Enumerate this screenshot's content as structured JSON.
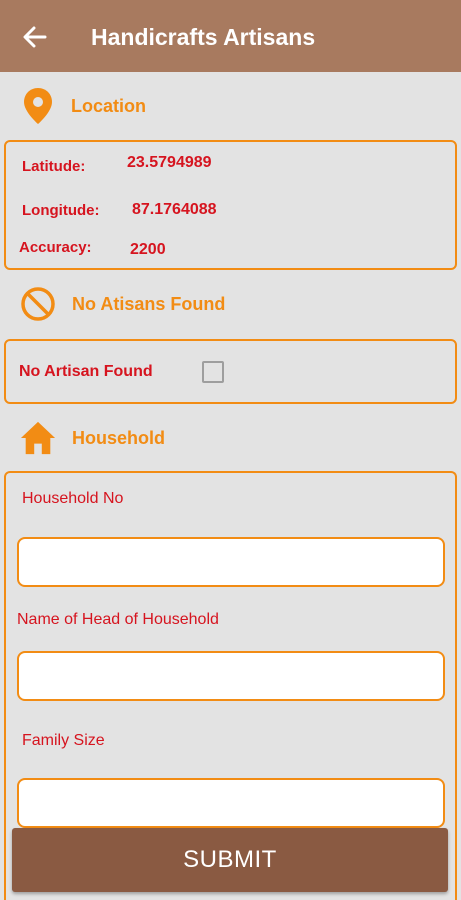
{
  "app_bar": {
    "title": "Handicrafts Artisans",
    "back_icon": "arrow-left-icon",
    "color": "#a87a5f"
  },
  "location": {
    "section_title": "Location",
    "icon": "location-pin-icon",
    "latitude_label": "Latitude:",
    "latitude_value": "23.5794989",
    "longitude_label": "Longitude:",
    "longitude_value": "87.1764088",
    "accuracy_label": "Accuracy:",
    "accuracy_value": "2200"
  },
  "no_artisans": {
    "section_title": "No Atisans Found",
    "icon": "prohibited-icon",
    "checkbox_label": "No Artisan Found",
    "checked": false
  },
  "household": {
    "section_title": "Household",
    "icon": "home-icon",
    "fields": [
      {
        "label": "Household No",
        "value": "",
        "placeholder": ""
      },
      {
        "label": "Name of Head of Household",
        "value": "",
        "placeholder": ""
      },
      {
        "label": "Family Size",
        "value": "",
        "placeholder": ""
      }
    ]
  },
  "submit_label": "SUBMIT",
  "colors": {
    "accent": "#f28c14",
    "label_red": "#d6141f",
    "submit": "#8a5a42",
    "background": "#e3e3e3"
  }
}
